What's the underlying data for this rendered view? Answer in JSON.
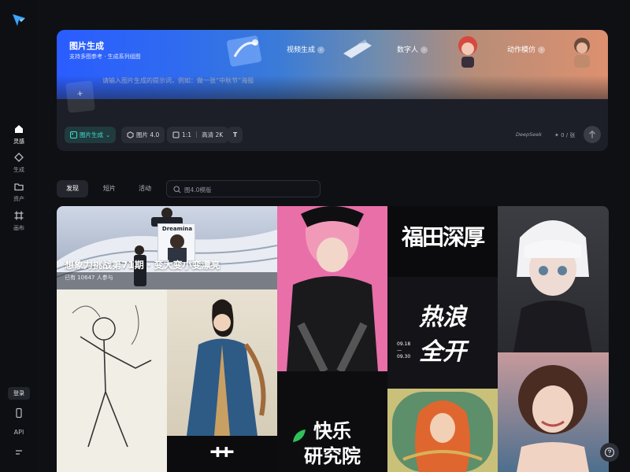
{
  "nav": {
    "items": [
      {
        "label": "灵感"
      },
      {
        "label": "生成"
      },
      {
        "label": "资产"
      },
      {
        "label": "画布"
      }
    ],
    "login_label": "登录",
    "api_label": "API"
  },
  "hero": {
    "title": "图片生成",
    "subtitle": "支持多图参考 · 生成系列组图",
    "tabs": [
      {
        "label": "视频生成"
      },
      {
        "label": "数字人"
      },
      {
        "label": "动作模仿"
      }
    ],
    "prompt_placeholder": "请输入图片生成的提示词，例如：做一张“中秋节”海报",
    "upload_icon": "+",
    "toolbar": {
      "mode_label": "图片生成",
      "model_label": "图片 4.0",
      "ratio_label": "1:1",
      "quality_label": "高清 2K",
      "text_tool_label": "T"
    },
    "deepseek_label": "DeepSeek",
    "credit_label": "✦ 0 / 张"
  },
  "filter": {
    "tabs": [
      {
        "label": "发现"
      },
      {
        "label": "短片"
      },
      {
        "label": "活动"
      }
    ],
    "search_placeholder": "图4.0模版"
  },
  "gallery": {
    "featured": {
      "banner_text": "Dreamina",
      "title": "想象力挑战第71期 · 变大变小变漂亮",
      "subtitle": "已有 10647 人参与"
    },
    "calligraphy": {
      "tile1": "福田深厚",
      "tile2_line1": "热浪",
      "tile2_line2": "全开",
      "tile2_dates": "09.18— 09.30",
      "tile3_line1": "快乐",
      "tile3_line2": "研究院",
      "tile4": "艹"
    }
  },
  "colors": {
    "accent": "#3ee0d0",
    "background": "#0f1014",
    "panel": "#1c1f27"
  }
}
